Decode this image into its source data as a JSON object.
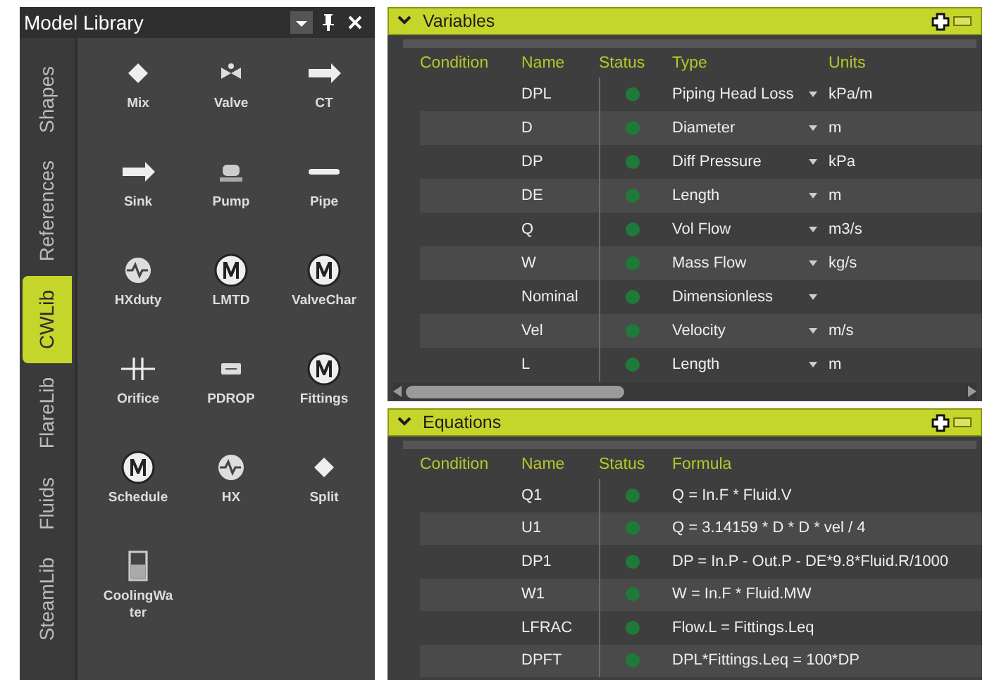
{
  "library": {
    "title": "Model Library",
    "tabs": [
      {
        "label": "Shapes",
        "selected": false
      },
      {
        "label": "References",
        "selected": false
      },
      {
        "label": "CWLib",
        "selected": true
      },
      {
        "label": "FlareLib",
        "selected": false
      },
      {
        "label": "Fluids",
        "selected": false
      },
      {
        "label": "SteamLib",
        "selected": false
      }
    ],
    "items": [
      {
        "label": "Mix",
        "kind": "diamond"
      },
      {
        "label": "Valve",
        "kind": "valve"
      },
      {
        "label": "CT",
        "kind": "arrow"
      },
      {
        "label": "Sink",
        "kind": "arrow"
      },
      {
        "label": "Pump",
        "kind": "pump"
      },
      {
        "label": "Pipe",
        "kind": "pipe"
      },
      {
        "label": "HXduty",
        "kind": "wave"
      },
      {
        "label": "LMTD",
        "kind": "m"
      },
      {
        "label": "ValveChar",
        "kind": "m"
      },
      {
        "label": "Orifice",
        "kind": "orifice"
      },
      {
        "label": "PDROP",
        "kind": "pdrop"
      },
      {
        "label": "Fittings",
        "kind": "m"
      },
      {
        "label": "Schedule",
        "kind": "m"
      },
      {
        "label": "HX",
        "kind": "wave"
      },
      {
        "label": "Split",
        "kind": "diamond"
      },
      {
        "label": "CoolingWater",
        "kind": "beaker"
      }
    ]
  },
  "variables": {
    "title": "Variables",
    "columns": [
      "Condition",
      "Name",
      "Status",
      "Type",
      "Units"
    ],
    "rows": [
      {
        "name": "DPL",
        "type": "Piping Head Loss",
        "units": "kPa/m"
      },
      {
        "name": "D",
        "type": "Diameter",
        "units": "m"
      },
      {
        "name": "DP",
        "type": "Diff Pressure",
        "units": "kPa"
      },
      {
        "name": "DE",
        "type": "Length",
        "units": "m"
      },
      {
        "name": "Q",
        "type": "Vol Flow",
        "units": "m3/s"
      },
      {
        "name": "W",
        "type": "Mass Flow",
        "units": "kg/s"
      },
      {
        "name": "Nominal",
        "type": "Dimensionless"
      },
      {
        "name": "Vel",
        "type": "Velocity",
        "units": "m/s"
      },
      {
        "name": "L",
        "type": "Length",
        "units": "m"
      }
    ]
  },
  "equations": {
    "title": "Equations",
    "columns": [
      "Condition",
      "Name",
      "Status",
      "Formula"
    ],
    "rows": [
      {
        "name": "Q1",
        "formula": "Q = In.F * Fluid.V"
      },
      {
        "name": "U1",
        "formula": "Q = 3.14159 * D * D * vel / 4"
      },
      {
        "name": "DP1",
        "formula": "DP = In.P - Out.P - DE*9.8*Fluid.R/1000"
      },
      {
        "name": "W1",
        "formula": "W = In.F * Fluid.MW"
      },
      {
        "name": "LFRAC",
        "formula": "Flow.L = Fittings.Leq"
      },
      {
        "name": "DPFT",
        "formula": "DPL*Fittings.Leq = 100*DP"
      }
    ]
  }
}
